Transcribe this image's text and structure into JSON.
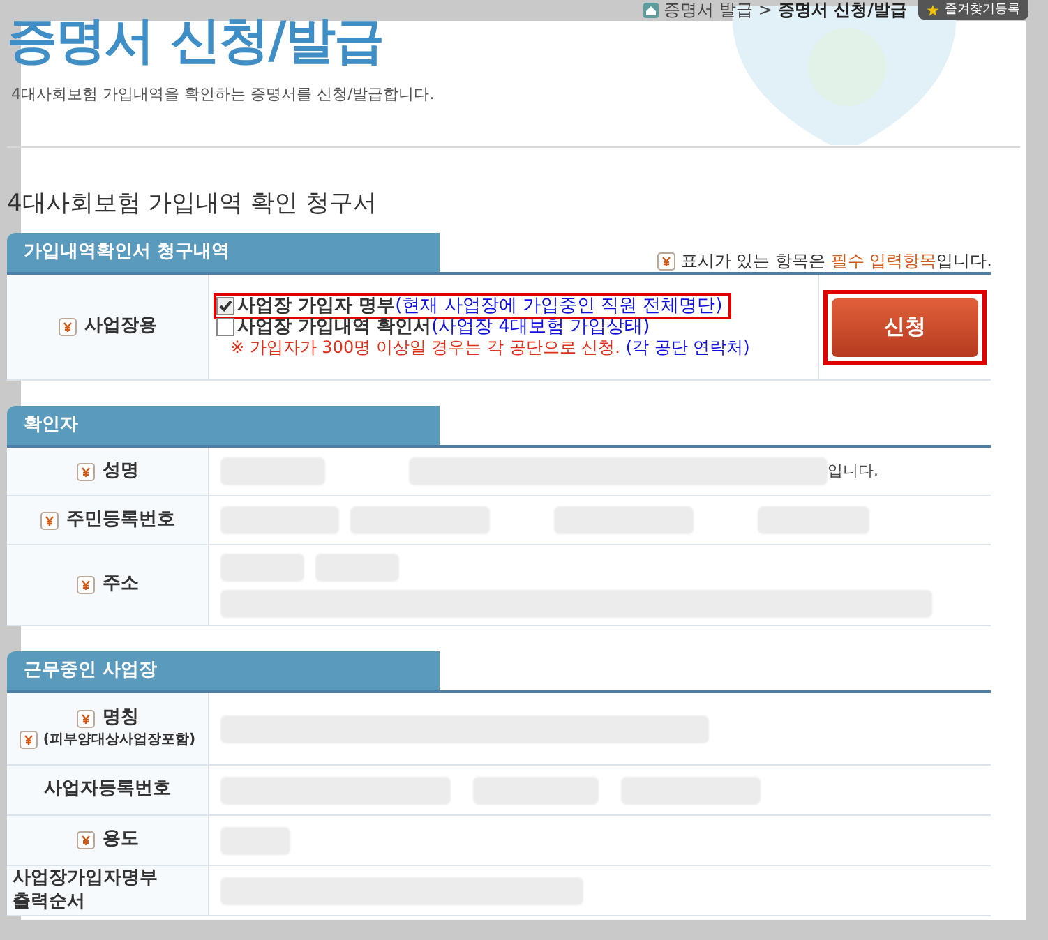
{
  "breadcrumb": {
    "items": [
      "증명서 발급",
      "증명서 신청/발급"
    ],
    "separator": ">",
    "bookmark": "즐겨찾기등록"
  },
  "title": "증명서 신청/발급",
  "subtitle": "4대사회보험 가입내역을 확인하는 증명서를 신청/발급합니다.",
  "form_title": "4대사회보험 가입내역 확인 청구서",
  "required_note": {
    "before": "표시가 있는 항목은 ",
    "emphasis": "필수 입력항목",
    "after": "입니다."
  },
  "request_section": {
    "title": "가입내역확인서 청구내역",
    "label": "사업장용",
    "required": true,
    "options": [
      {
        "label": "사업장 가입자 명부",
        "note": "(현재 사업장에 가입중인 직원 전체명단)",
        "checked": true,
        "highlighted": true
      },
      {
        "label": "사업장 가입내역 확인서",
        "note": "(사업장 4대보험 가입상태)",
        "checked": false,
        "highlighted": false
      }
    ],
    "warning": "※ 가입자가 300명 이상일 경우는 각 공단으로 신청.",
    "contact": "(각 공단 연락처)",
    "submit": "신청",
    "submit_highlighted": true
  },
  "verifier_section": {
    "title": "확인자",
    "rows": [
      {
        "label": "성명",
        "required": true,
        "tail": "입니다."
      },
      {
        "label": "주민등록번호",
        "required": true
      },
      {
        "label": "주소",
        "required": true
      }
    ]
  },
  "workplace_section": {
    "title": "근무중인 사업장",
    "rows": [
      {
        "label": "명칭",
        "sublabel": "(피부양대상사업장포함)",
        "required": true
      },
      {
        "label": "사업자등록번호",
        "required": false
      },
      {
        "label": "용도",
        "required": true
      },
      {
        "label": "사업장가입자명부 출력순서",
        "required": false
      }
    ]
  }
}
